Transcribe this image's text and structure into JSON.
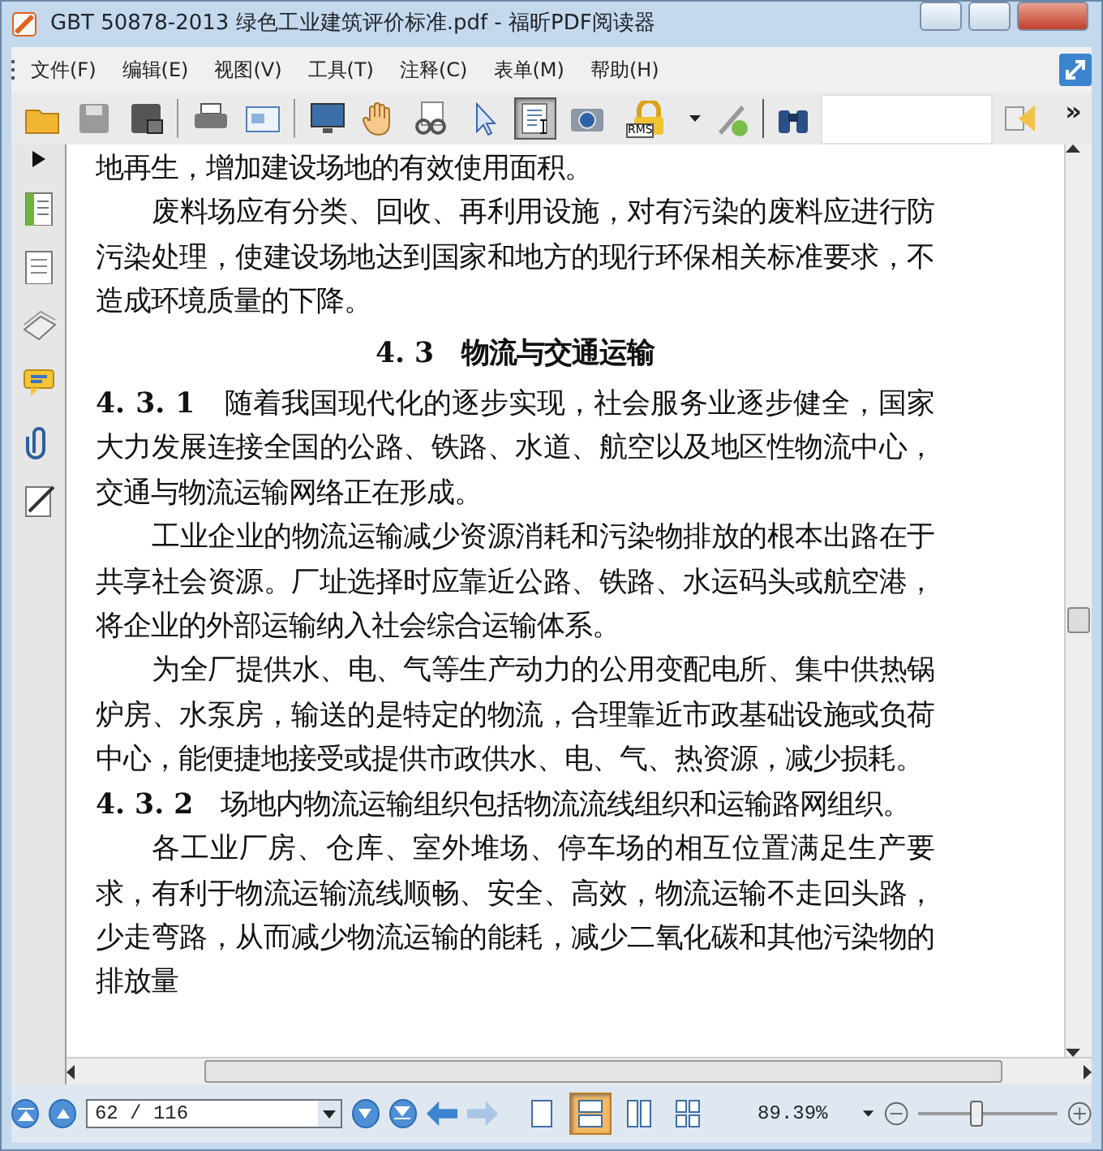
{
  "window": {
    "title": "GBT 50878-2013 绿色工业建筑评价标准.pdf - 福昕PDF阅读器"
  },
  "menu": [
    {
      "label": "文件(F)"
    },
    {
      "label": "编辑(E)"
    },
    {
      "label": "视图(V)"
    },
    {
      "label": "工具(T)"
    },
    {
      "label": "注释(C)"
    },
    {
      "label": "表单(M)"
    },
    {
      "label": "帮助(H)"
    }
  ],
  "toolbar": {
    "tools": [
      {
        "kind": "open",
        "selected": false
      },
      {
        "kind": "save",
        "selected": false
      },
      {
        "kind": "saveas",
        "selected": false
      },
      {
        "kind": "sep"
      },
      {
        "kind": "print",
        "selected": false
      },
      {
        "kind": "email",
        "selected": false
      },
      {
        "kind": "sep"
      },
      {
        "kind": "monitor",
        "selected": false
      },
      {
        "kind": "hand",
        "selected": false
      },
      {
        "kind": "zoom",
        "selected": false
      },
      {
        "kind": "pointer",
        "selected": false
      },
      {
        "kind": "textselect",
        "selected": true
      },
      {
        "kind": "camera",
        "selected": false
      },
      {
        "kind": "lock",
        "selected": false
      },
      {
        "kind": "pen",
        "selected": false
      }
    ],
    "rms_label": "RMS",
    "more": "»"
  },
  "document": {
    "paragraphs": [
      {
        "kind": "continued",
        "text": "地再生，增加建设场地的有效使用面积。"
      },
      {
        "kind": "indent",
        "text": "废料场应有分类、回收、再利用设施，对有污染的废料应进行防污染处理，使建设场地达到国家和地方的现行环保相关标准要求，不造成环境质量的下降。"
      },
      {
        "kind": "heading",
        "text": "4. 3　物流与交通运输"
      },
      {
        "kind": "clause",
        "text": "**4. 3. 1**　随着我国现代化的逐步实现，社会服务业逐步健全，国家大力发展连接全国的公路、铁路、水道、航空以及地区性物流中心，交通与物流运输网络正在形成。"
      },
      {
        "kind": "indent",
        "text": "工业企业的物流运输减少资源消耗和污染物排放的根本出路在于共享社会资源。厂址选择时应靠近公路、铁路、水运码头或航空港，将企业的外部运输纳入社会综合运输体系。"
      },
      {
        "kind": "indent",
        "text": "为全厂提供水、电、气等生产动力的公用变配电所、集中供热锅炉房、水泵房，输送的是特定的物流，合理靠近市政基础设施或负荷中心，能便捷地接受或提供市政供水、电、气、热资源，减少损耗。"
      },
      {
        "kind": "clause",
        "text": "**4. 3. 2**　场地内物流运输组织包括物流流线组织和运输路网组织。"
      },
      {
        "kind": "indent",
        "text": "各工业厂房、仓库、室外堆场、停车场的相互位置满足生产要求，有利于物流运输流线顺畅、安全、高效，物流运输不走回头路，少走弯路，从而减少物流运输的能耗，减少二氧化碳和其他污染物的排放量"
      }
    ]
  },
  "status": {
    "page": "62 / 116",
    "zoom": "89.39%",
    "zoom_slider": {
      "level": 0.42
    },
    "views": [
      {
        "selected": false
      },
      {
        "selected": true
      },
      {
        "selected": false
      },
      {
        "selected": false
      }
    ]
  }
}
